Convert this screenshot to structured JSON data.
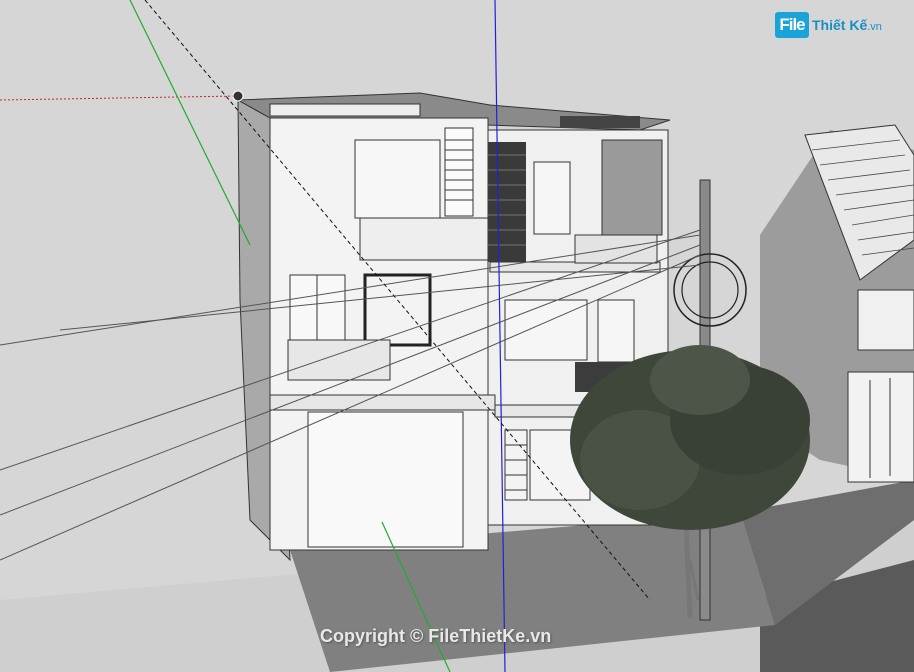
{
  "app": {
    "window": "sketchup-3d-viewport",
    "model": "three-storey-townhouse"
  },
  "watermark": {
    "logo_badge": "File",
    "logo_name": "Thiết Kế",
    "logo_suffix": ".vn",
    "copyright": "Copyright © FileThietKe.vn"
  },
  "colors": {
    "background": "#d6d6d6",
    "axis_red": "#d02020",
    "axis_green": "#1fae2a",
    "axis_blue": "#2020d8",
    "wall_light": "#f3f3f3",
    "wall_shade": "#a9a9a9",
    "roof": "#8a8a8a",
    "ground": "#7b7b7b",
    "tree": "#3f463a",
    "logo_blue": "#1aa3d9"
  },
  "icons": {
    "axis_origin": "origin-point-icon",
    "tree": "tree-icon"
  }
}
